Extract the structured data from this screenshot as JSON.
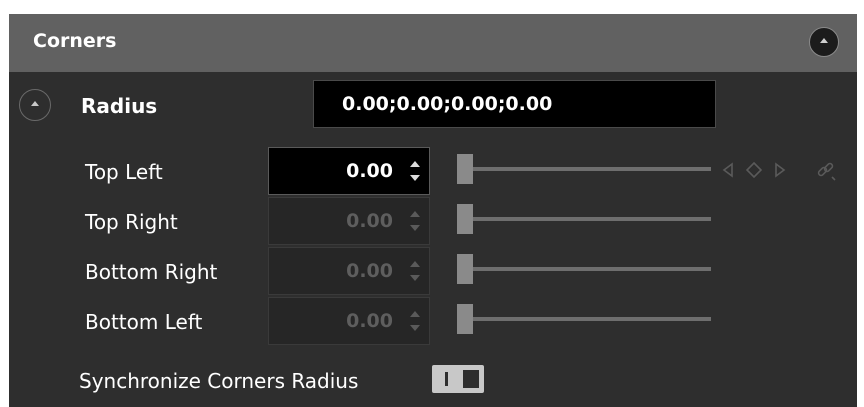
{
  "section": {
    "title": "Corners"
  },
  "radius": {
    "label": "Radius",
    "value": "0.00;0.00;0.00;0.00"
  },
  "corners": [
    {
      "label": "Top Left",
      "value": "0.00",
      "slider_fraction": 0,
      "active": true
    },
    {
      "label": "Top Right",
      "value": "0.00",
      "slider_fraction": 0,
      "active": false
    },
    {
      "label": "Bottom Right",
      "value": "0.00",
      "slider_fraction": 0,
      "active": false
    },
    {
      "label": "Bottom Left",
      "value": "0.00",
      "slider_fraction": 0,
      "active": false
    }
  ],
  "keyframe_icons": [
    "prev-keyframe-icon",
    "keyframe-diamond-icon",
    "next-keyframe-icon",
    "link-icon"
  ],
  "sync": {
    "label": "Synchronize Corners Radius",
    "on": true
  },
  "colors": {
    "panel_bg": "#2e2e2e",
    "header_bg": "#616161",
    "field_bg": "#000000",
    "text": "#ffffff",
    "disabled_text": "#5e5e5e"
  }
}
